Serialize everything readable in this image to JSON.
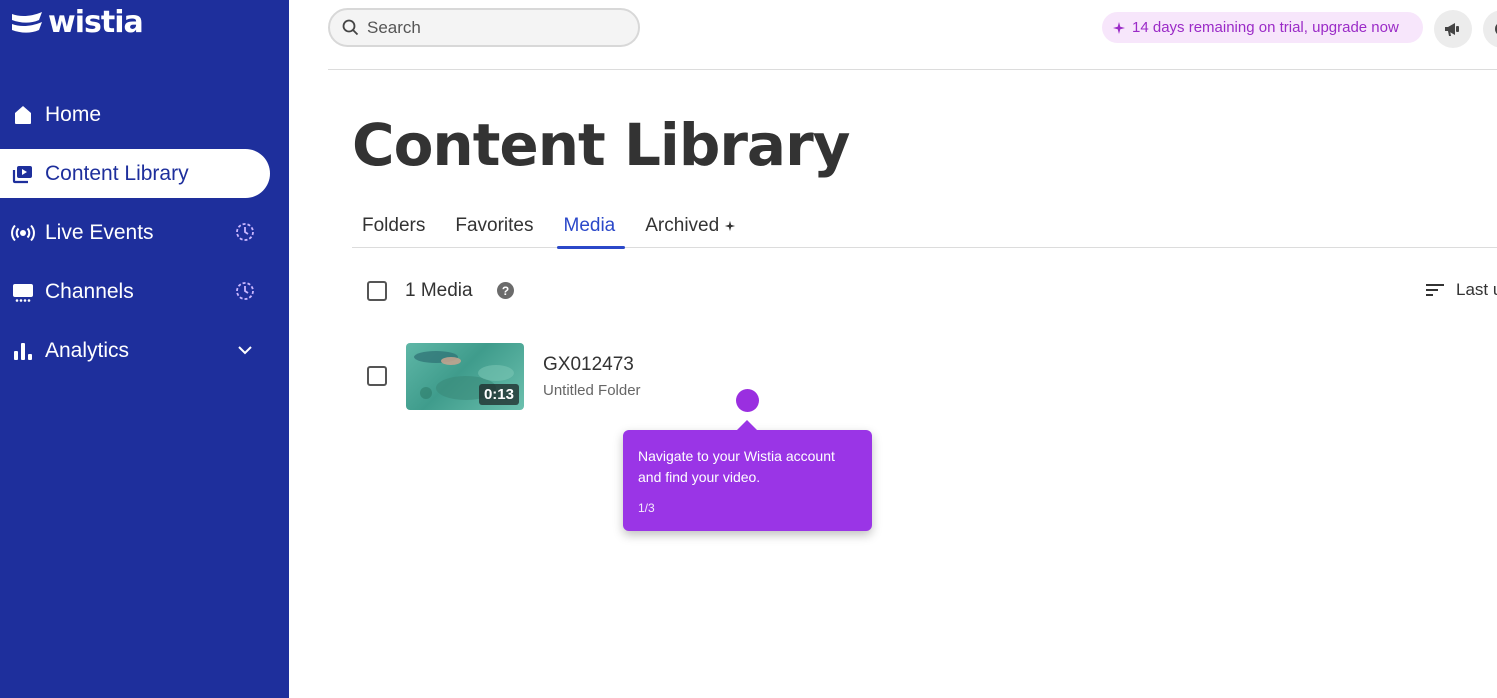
{
  "app": {
    "brand": "wistia"
  },
  "sidebar": {
    "items": [
      {
        "label": "Home",
        "icon": "home-icon"
      },
      {
        "label": "Content Library",
        "icon": "library-icon",
        "active": true
      },
      {
        "label": "Live Events",
        "icon": "broadcast-icon",
        "trail_icon": "clock-icon"
      },
      {
        "label": "Channels",
        "icon": "channels-icon",
        "trail_icon": "clock-icon"
      },
      {
        "label": "Analytics",
        "icon": "analytics-icon",
        "trail_icon": "chevron-down-icon"
      }
    ]
  },
  "header": {
    "search_placeholder": "Search",
    "trial_banner": "14 days remaining on trial, upgrade now"
  },
  "main": {
    "title": "Content Library",
    "tabs": [
      {
        "label": "Folders"
      },
      {
        "label": "Favorites"
      },
      {
        "label": "Media",
        "active": true
      },
      {
        "label": "Archived"
      }
    ],
    "media_count": "1 Media",
    "help_glyph": "?",
    "sort_label": "Last u",
    "media": [
      {
        "title": "GX012473",
        "folder": "Untitled Folder",
        "duration": "0:13"
      }
    ]
  },
  "tour": {
    "text": "Navigate to your Wistia account and find your video.",
    "step": "1/3"
  },
  "colors": {
    "sidebar_bg": "#1e2f9c",
    "accent": "#2b48c9",
    "tour": "#9a35e6",
    "trial_text": "#9b2bc7"
  }
}
